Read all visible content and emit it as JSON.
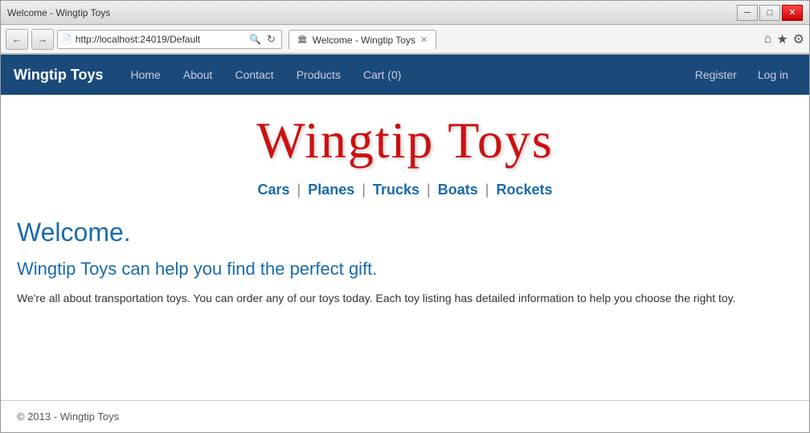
{
  "window": {
    "title": "Welcome - Wingtip Toys",
    "minimize_label": "─",
    "maximize_label": "□",
    "close_label": "✕"
  },
  "address_bar": {
    "url": "http://localhost:24019/Default",
    "tab_title": "Welcome - Wingtip Toys"
  },
  "navbar": {
    "brand": "Wingtip Toys",
    "links": [
      {
        "label": "Home"
      },
      {
        "label": "About"
      },
      {
        "label": "Contact"
      },
      {
        "label": "Products"
      },
      {
        "label": "Cart (0)"
      }
    ],
    "right_links": [
      {
        "label": "Register"
      },
      {
        "label": "Log in"
      }
    ]
  },
  "hero": {
    "title": "Wingtip Toys"
  },
  "categories": {
    "items": [
      {
        "label": "Cars"
      },
      {
        "label": "Planes"
      },
      {
        "label": "Trucks"
      },
      {
        "label": "Boats"
      },
      {
        "label": "Rockets"
      }
    ]
  },
  "content": {
    "heading": "Welcome.",
    "subheading": "Wingtip Toys can help you find the perfect gift.",
    "body": "We're all about transportation toys. You can order any of our toys today. Each toy listing has detailed information to help you choose the right toy."
  },
  "footer": {
    "copyright": "© 2013 - Wingtip Toys"
  }
}
